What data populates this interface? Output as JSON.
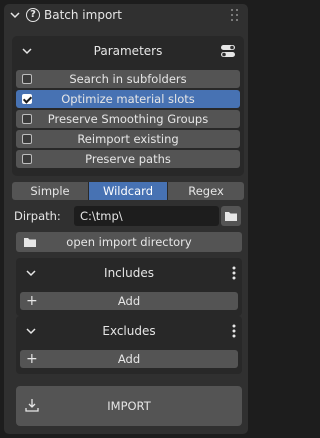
{
  "panel": {
    "title": "Batch import"
  },
  "parameters": {
    "label": "Parameters",
    "options": [
      {
        "label": "Search in subfolders",
        "checked": false
      },
      {
        "label": "Optimize material slots",
        "checked": true
      },
      {
        "label": "Preserve Smoothing Groups",
        "checked": false
      },
      {
        "label": "Reimport existing",
        "checked": false
      },
      {
        "label": "Preserve paths",
        "checked": false
      }
    ]
  },
  "tabs": [
    {
      "label": "Simple"
    },
    {
      "label": "Wildcard",
      "active": true
    },
    {
      "label": "Regex"
    }
  ],
  "dirpath": {
    "label": "Dirpath:",
    "value": "C:\\tmp\\"
  },
  "open_dir": {
    "label": "open import directory"
  },
  "includes": {
    "label": "Includes",
    "add_label": "Add"
  },
  "excludes": {
    "label": "Excludes",
    "add_label": "Add"
  },
  "import_btn": {
    "label": "IMPORT"
  },
  "colors": {
    "accent": "#4772b3",
    "panel": "#303030",
    "button": "#545454",
    "field": "#1d1d1d"
  }
}
